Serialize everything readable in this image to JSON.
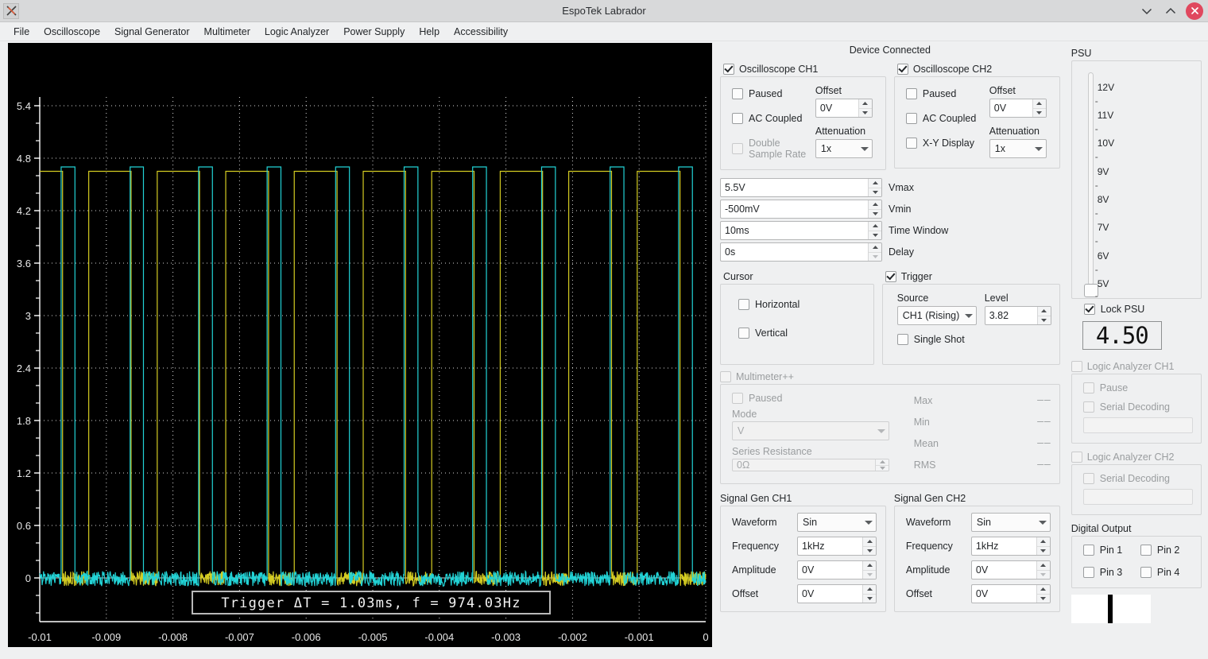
{
  "window": {
    "title": "EspoTek Labrador",
    "icon": "app-icon",
    "minimize": "˅",
    "maximize": "˄",
    "close": "✕"
  },
  "menubar": {
    "items": [
      {
        "label": "File"
      },
      {
        "label": "Oscilloscope"
      },
      {
        "label": "Signal Generator"
      },
      {
        "label": "Multimeter"
      },
      {
        "label": "Logic Analyzer"
      },
      {
        "label": "Power Supply"
      },
      {
        "label": "Help"
      },
      {
        "label": "Accessibility"
      }
    ]
  },
  "scope": {
    "annotation": "Trigger ΔT = 1.03ms, f = 974.03Hz",
    "ch1_color": "#d4cc22",
    "ch2_color": "#22d3d6",
    "background": "#000000",
    "grid_color": "#ffffff"
  },
  "chart_data": {
    "type": "line",
    "title": "",
    "xlabel": "",
    "ylabel": "",
    "xlim": [
      -0.01,
      0
    ],
    "ylim": [
      -0.5,
      5.5
    ],
    "xticks": [
      "-0.01",
      "-0.009",
      "-0.008",
      "-0.007",
      "-0.006",
      "-0.005",
      "-0.004",
      "-0.003",
      "-0.002",
      "-0.001",
      "0"
    ],
    "yticks": [
      "0",
      "0.6",
      "1.2",
      "1.8",
      "2.4",
      "3",
      "3.6",
      "4.2",
      "4.8",
      "5.4"
    ],
    "grid": true,
    "legend": "none",
    "annotations": [
      "Trigger ΔT = 1.03ms, f = 974.03Hz"
    ],
    "series": [
      {
        "name": "CH1",
        "color": "#d4cc22",
        "waveform": "square",
        "frequency_hz": 974.03,
        "period_ms": 1.03,
        "v_high": 4.65,
        "v_low": 0.0,
        "duty_cycle": 0.62,
        "phase_offset_ms": 0.0
      },
      {
        "name": "CH2",
        "color": "#22d3d6",
        "waveform": "square",
        "frequency_hz": 974.03,
        "period_ms": 1.03,
        "v_high": 4.7,
        "v_low": 0.0,
        "duty_cycle": 0.2,
        "phase_offset_ms": 0.62
      }
    ]
  },
  "center": {
    "device_status": "Device Connected",
    "ch1": {
      "title": "Oscilloscope CH1",
      "enabled": true,
      "paused_label": "Paused",
      "paused": false,
      "ac_coupled_label": "AC Coupled",
      "ac_coupled": false,
      "double_sample_label": "Double Sample Rate",
      "double_sample": false,
      "offset_label": "Offset",
      "offset_value": "0V",
      "attenuation_label": "Attenuation",
      "attenuation_value": "1x"
    },
    "ch2": {
      "title": "Oscilloscope CH2",
      "enabled": true,
      "paused_label": "Paused",
      "paused": false,
      "ac_coupled_label": "AC Coupled",
      "ac_coupled": false,
      "xy_label": "X-Y Display",
      "xy": false,
      "offset_label": "Offset",
      "offset_value": "0V",
      "attenuation_label": "Attenuation",
      "attenuation_value": "1x"
    },
    "fields": [
      {
        "value": "5.5V",
        "name": "Vmax"
      },
      {
        "value": "-500mV",
        "name": "Vmin"
      },
      {
        "value": "10ms",
        "name": "Time Window"
      },
      {
        "value": "0s",
        "name": "Delay"
      }
    ],
    "cursor": {
      "title": "Cursor",
      "horizontal_label": "Horizontal",
      "horizontal": false,
      "vertical_label": "Vertical",
      "vertical": false
    },
    "trigger": {
      "title": "Trigger",
      "enabled": true,
      "source_label": "Source",
      "source_value": "CH1 (Rising)",
      "level_label": "Level",
      "level_value": "3.82",
      "single_shot_label": "Single Shot",
      "single_shot": false
    },
    "multimeter": {
      "title": "Multimeter++",
      "enabled": false,
      "paused_label": "Paused",
      "mode_label": "Mode",
      "mode_value": "V",
      "series_resistance_label": "Series Resistance",
      "series_resistance_value": "0Ω",
      "readouts": [
        {
          "label": "Max",
          "value": "––"
        },
        {
          "label": "Min",
          "value": "––"
        },
        {
          "label": "Mean",
          "value": "––"
        },
        {
          "label": "RMS",
          "value": "––"
        }
      ]
    },
    "siggen1": {
      "title": "Signal Gen CH1",
      "waveform_label": "Waveform",
      "waveform_value": "Sin",
      "frequency_label": "Frequency",
      "frequency_value": "1kHz",
      "amplitude_label": "Amplitude",
      "amplitude_value": "0V",
      "offset_label": "Offset",
      "offset_value": "0V"
    },
    "siggen2": {
      "title": "Signal Gen CH2",
      "waveform_label": "Waveform",
      "waveform_value": "Sin",
      "frequency_label": "Frequency",
      "frequency_value": "1kHz",
      "amplitude_label": "Amplitude",
      "amplitude_value": "0V",
      "offset_label": "Offset",
      "offset_value": "0V"
    }
  },
  "right": {
    "psu": {
      "title": "PSU",
      "ticks": [
        "12V",
        "11V",
        "10V",
        "9V",
        "8V",
        "7V",
        "6V",
        "5V"
      ],
      "lock_label": "Lock PSU",
      "locked": true,
      "display_value": "4.50"
    },
    "la1": {
      "title": "Logic Analyzer CH1",
      "enabled": false,
      "pause_label": "Pause",
      "serial_decoding_label": "Serial Decoding",
      "serial_value": ""
    },
    "la2": {
      "title": "Logic Analyzer CH2",
      "enabled": false,
      "serial_decoding_label": "Serial Decoding",
      "serial_value": ""
    },
    "digital_output": {
      "title": "Digital Output",
      "pins": [
        {
          "label": "Pin 1",
          "on": false
        },
        {
          "label": "Pin 2",
          "on": false
        },
        {
          "label": "Pin 3",
          "on": false
        },
        {
          "label": "Pin 4",
          "on": false
        }
      ]
    }
  }
}
